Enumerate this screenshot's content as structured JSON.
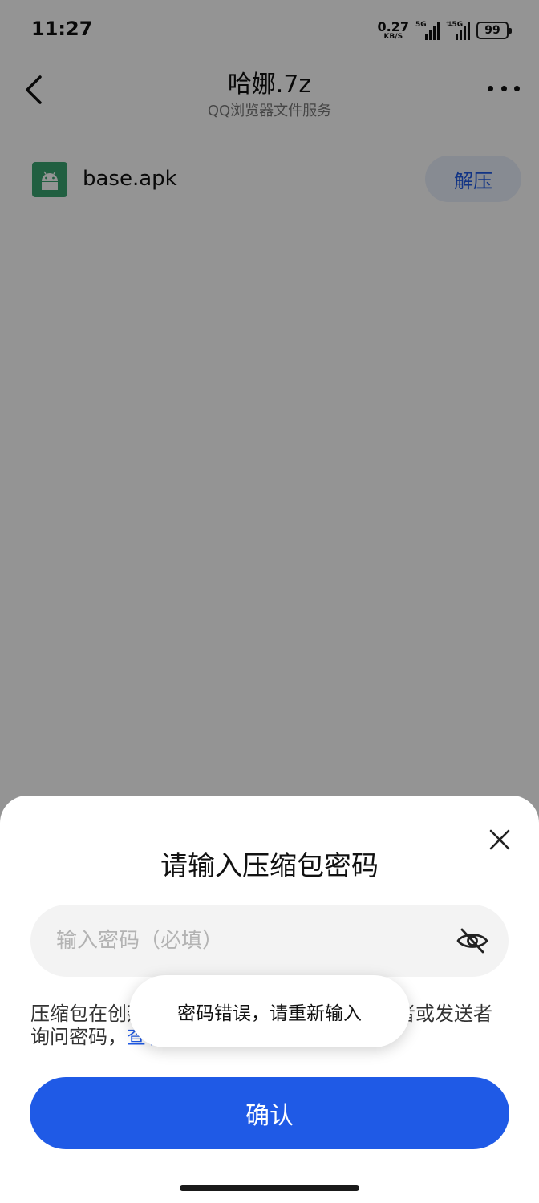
{
  "status_bar": {
    "time": "11:27",
    "net_speed_value": "0.27",
    "net_speed_unit": "KB/S",
    "sim1_tag": "5G",
    "sim2_tag": "⇅5G",
    "battery": "99"
  },
  "nav": {
    "title": "哈娜.7z",
    "subtitle": "QQ浏览器文件服务"
  },
  "file": {
    "name": "base.apk",
    "extract_label": "解压",
    "icon_color": "#3aa471"
  },
  "dialog": {
    "title": "请输入压缩包密码",
    "password_placeholder": "输入密码（必填）",
    "password_value": "",
    "hint_text": "压缩包在创建时已加密，可以向压缩包创建者或发送者询问密码，",
    "hint_link": "查看详情。",
    "confirm_label": "确认"
  },
  "toast": {
    "message": "密码错误，请重新输入"
  },
  "colors": {
    "accent": "#1f5ae6",
    "scrim": "rgba(0,0,0,0.42)"
  }
}
